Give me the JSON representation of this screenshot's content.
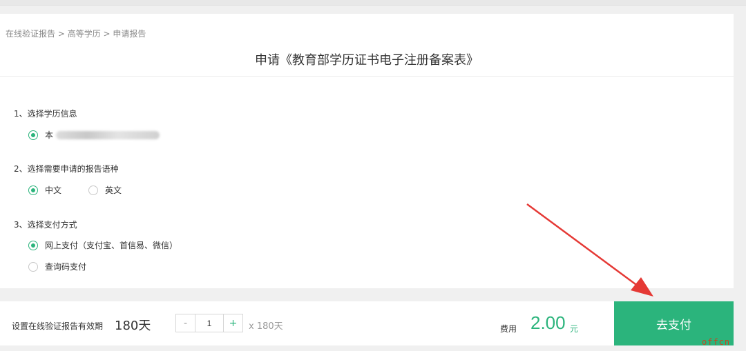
{
  "breadcrumb": {
    "item1": "在线验证报告",
    "sep1": " > ",
    "item2": "高等学历",
    "sep2": " > ",
    "item3": "申请报告"
  },
  "page_title": "申请《教育部学历证书电子注册备案表》",
  "section1": {
    "title": "1、选择学历信息",
    "option_label": "本"
  },
  "section2": {
    "title": "2、选择需要申请的报告语种",
    "options": [
      {
        "label": "中文",
        "checked": true
      },
      {
        "label": "英文",
        "checked": false
      }
    ]
  },
  "section3": {
    "title": "3、选择支付方式",
    "options": [
      {
        "label": "网上支付（支付宝、首信易、微信）",
        "checked": true
      },
      {
        "label": "查询码支付",
        "checked": false
      }
    ]
  },
  "footer": {
    "validity_label": "设置在线验证报告有效期",
    "validity_value": "180天",
    "minus_label": "-",
    "quantity": "1",
    "plus_label": "+",
    "multiplier": "x 180天",
    "fee_label": "费用",
    "fee_amount": "2.00",
    "fee_unit": "元",
    "pay_label": "去支付"
  },
  "colors": {
    "accent": "#2bb47c",
    "annotation_arrow": "#e53935"
  },
  "watermark": "offcn"
}
